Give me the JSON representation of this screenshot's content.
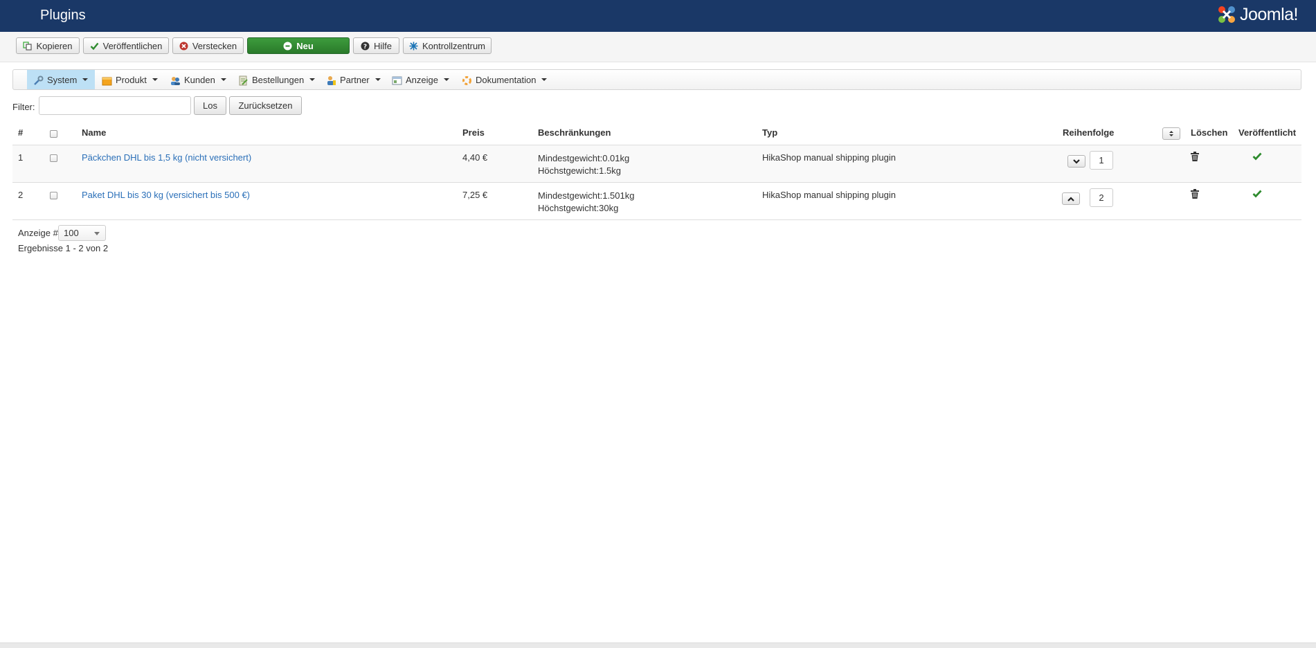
{
  "header": {
    "title": "Plugins",
    "logo_text": "Joomla!"
  },
  "toolbar": {
    "copy": "Kopieren",
    "publish": "Veröffentlichen",
    "hide": "Verstecken",
    "new": "Neu",
    "help": "Hilfe",
    "dashboard": "Kontrollzentrum"
  },
  "menu": [
    {
      "label": "System",
      "icon": "wrench-icon"
    },
    {
      "label": "Produkt",
      "icon": "box-icon"
    },
    {
      "label": "Kunden",
      "icon": "users-icon"
    },
    {
      "label": "Bestellungen",
      "icon": "orders-icon"
    },
    {
      "label": "Partner",
      "icon": "partner-icon"
    },
    {
      "label": "Anzeige",
      "icon": "display-icon"
    },
    {
      "label": "Dokumentation",
      "icon": "help-ring-icon"
    }
  ],
  "filter": {
    "label": "Filter:",
    "value": "",
    "go": "Los",
    "reset": "Zurücksetzen"
  },
  "table": {
    "headers": {
      "num": "#",
      "name": "Name",
      "price": "Preis",
      "restrictions": "Beschränkungen",
      "type": "Typ",
      "ordering": "Reihenfolge",
      "delete": "Löschen",
      "published": "Veröffentlicht"
    },
    "rows": [
      {
        "num": "1",
        "name": "Päckchen DHL bis 1,5 kg (nicht versichert)",
        "price": "4,40 €",
        "restriction_min": "Mindestgewicht:0.01kg",
        "restriction_max": "Höchstgewicht:1.5kg",
        "type": "HikaShop manual shipping plugin",
        "order": "1"
      },
      {
        "num": "2",
        "name": "Paket DHL bis 30 kg (versichert bis 500 €)",
        "price": "7,25 €",
        "restriction_min": "Mindestgewicht:1.501kg",
        "restriction_max": "Höchstgewicht:30kg",
        "type": "HikaShop manual shipping plugin",
        "order": "2"
      }
    ]
  },
  "footer": {
    "display_label": "Anzeige #",
    "display_value": "100",
    "results": "Ergebnisse 1 - 2 von 2"
  },
  "colors": {
    "header_bg": "#1a3867",
    "link": "#2a6fb8",
    "new_button": "#2f8a2f",
    "check": "#2e8b2e",
    "active_menu": "#bde0f5"
  }
}
